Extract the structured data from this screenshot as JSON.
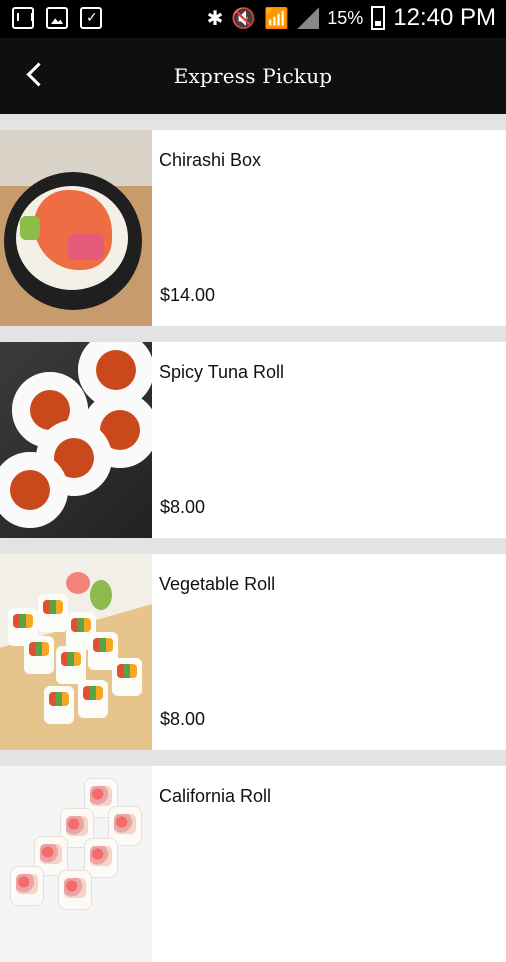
{
  "status_bar": {
    "battery_pct": "15%",
    "time": "12:40 PM"
  },
  "header": {
    "title": "Express Pickup"
  },
  "items": [
    {
      "name": "Chirashi Box",
      "price": "$14.00",
      "image": "chirashi-bowl"
    },
    {
      "name": "Spicy Tuna Roll",
      "price": "$8.00",
      "image": "spicy-tuna-roll"
    },
    {
      "name": "Vegetable Roll",
      "price": "$8.00",
      "image": "vegetable-roll"
    },
    {
      "name": "California Roll",
      "price": "",
      "image": "california-roll"
    }
  ],
  "colors": {
    "header_bg": "#0f0f0f",
    "list_bg": "#ffffff",
    "divider": "#e3e3e3",
    "text": "#111111"
  }
}
